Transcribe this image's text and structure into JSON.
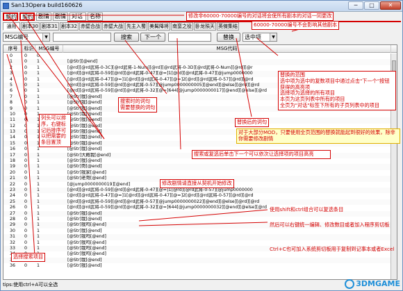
{
  "window": {
    "title": "San13Opera build160626",
    "min": "─",
    "max": "□",
    "close": "✕"
  },
  "top_tabs": [
    "契约",
    "契约",
    "剧情",
    "剧情",
    "对话",
    "名称"
  ],
  "sub_tabs": [
    "通用",
    "剧本30",
    "剧本31",
    "剧本32",
    "赤壁合战",
    "赤壁大战",
    "先主入蜀",
    "美髯降将",
    "南蛮之役",
    "卧龙殒天",
    "英傑集结"
  ],
  "toolbar": {
    "field_combo": "MSG编号",
    "search_btn": "搜索",
    "next_btn": "下一个",
    "replace_btn": "替换",
    "scope_combo": "选中项"
  },
  "grid": {
    "columns": [
      "序号",
      "标识",
      "MSG编号",
      "MSG代码"
    ],
    "rows": [
      [
        "0",
        "0",
        "0",
        ""
      ],
      [
        "1",
        "0",
        "1",
        "[@Str][@end]"
      ],
      [
        "2",
        "0",
        "1",
        "[@rd][@rd武将-0-3C][@rd武将-1-Num][@rd][@rd武将-0-3D][@rd武将-0-Num][@rd][@r"
      ],
      [
        "3",
        "0",
        "1",
        "[@rd][@rd武将-0-59][@rd][@rd武将-0-47][@=]1[@rd][@rd武将-0-47][@jump0000000"
      ],
      [
        "4",
        "0",
        "1",
        "[@rd][@rd武将-0-47][@=]1[@rd][@rd武将-0-47][@=]2[@rd][@rd武将-0-57][@rd][@rd"
      ],
      [
        "5",
        "0",
        "1",
        "[@rd][@rd武将-0-59][@rd][@rd武将-0-57][@jump0000000005][@end][@else][@rd][@rd"
      ],
      [
        "6",
        "0",
        "1",
        "[@rd][@rd武将-0-59][@rd][@rd武将-0-32][@=]644[@jump0000000017][@end][@else][@rd"
      ],
      [
        "7",
        "0",
        "1",
        "[@Str]我[@end]"
      ],
      [
        "8",
        "0",
        "1",
        "[@Str]我[@end]"
      ],
      [
        "9",
        "0",
        "1",
        "[@Str]我[@end]"
      ],
      [
        "10",
        "0",
        "1",
        "[@Str]我[@end]"
      ],
      [
        "11",
        "0",
        "1",
        "[@Str]我[@end]"
      ],
      [
        "12",
        "0",
        "1",
        "[@Str]我[@end]"
      ],
      [
        "13",
        "0",
        "1",
        "[@Str]我[@end]"
      ],
      [
        "14",
        "0",
        "1",
        "[@Str]我[@end]"
      ],
      [
        "15",
        "0",
        "1",
        "[@Str]我[@end]"
      ],
      [
        "16",
        "0",
        "1",
        "[@Str]我[@end]"
      ],
      [
        "17",
        "0",
        "1",
        "[@Str]大概我[@end]"
      ],
      [
        "18",
        "0",
        "1",
        "[@Str]我[@end]"
      ],
      [
        "19",
        "0",
        "1",
        "[@Str]哥[@end]"
      ],
      [
        "20",
        "0",
        "1",
        "[@Str]我家[@end]"
      ],
      [
        "21",
        "0",
        "1",
        "[@Str]老哥[@end]"
      ],
      [
        "22",
        "0",
        "1",
        "[@jump0000000019][@end]"
      ],
      [
        "23",
        "0",
        "1",
        "[@rd][@rd武将-0-59][@rd][@rd武将-0-47][@=]1[@rd][@rd武将-0-57][@jump0000000"
      ],
      [
        "24",
        "0",
        "1",
        "[@rd][@rd武将-0-47][@=]1[@rd][@rd武将-0-47][@=]2[@rd][@rd武将-0-57][@rd][@rd"
      ],
      [
        "25",
        "0",
        "1",
        "[@rd][@rd武将-0-59][@rd][@rd武将-0-57][@jump0000000022][@end][@else][@rd][@rd"
      ],
      [
        "26",
        "0",
        "1",
        "[@rd][@rd武将-0-59][@rd][@rd武将-0-32][@=]644[@jump0000000032][@end][@else][@rd"
      ],
      [
        "27",
        "0",
        "1",
        "[@Str]我[@end]"
      ],
      [
        "28",
        "0",
        "1",
        "[@Str]我[@end]"
      ],
      [
        "29",
        "0",
        "1",
        "[@Str]我吗[@end]"
      ],
      [
        "30",
        "0",
        "1",
        "[@Str]我[@end]"
      ],
      [
        "31",
        "0",
        "1",
        "[@Str]我吗[@end]"
      ],
      [
        "32",
        "0",
        "1",
        "[@Str]我吗[@end]"
      ],
      [
        "33",
        "0",
        "1",
        "[@Str]我吗[@end]"
      ],
      [
        "34",
        "0",
        "1",
        "[@Str]我吗[@end]"
      ],
      [
        "35",
        "0",
        "1",
        "[@Str]我[@end]"
      ],
      [
        "36",
        "0",
        "1",
        "[@Str]我[@end]"
      ]
    ]
  },
  "status": "tips:使用ctrl+A可以全选",
  "annotations": {
    "top": "修改非60000-70000编号的对话将会使所有剧本的对话一同更改",
    "top2": "60000-70000编号不会影响其他剧本",
    "scope_title": "替换的范围",
    "scope_body": "选中项为选中的复数项目中通过点击\"下一个\"按钮获得的高亮项\n选择项为选择的所有项目\n本页为这页列表中所有的项目\n全页为\"对话\"标签下所有的子页列表中的项目",
    "replace_word": "替换后的词句",
    "mod_tip": "对于大部分MOD，只要使用全页范围的替换就能起到很好的效果，除非你需要修改剧情",
    "col_tip": "列头可以排序，右键标记后排序可以把需要的条目置顶",
    "search_word": "搜索时的词句\n需要替换的词句",
    "next_tip": "搜索或复选后单击下一个可以依次让选择项的项目高亮",
    "edit_story": "修改剧情请直接从契机开始修改",
    "multi_select": "使用shift和ctrl组合可以复选条目",
    "right_click": "然后可以右键统一编辑、修改数目或者加入程序剪切板",
    "ctrl_c": "Ctrl+C也可加入系统剪切板用于复制到记事本或者Excel",
    "choose_item": "选择搜索项目",
    "watermark": "3DMGAME"
  }
}
